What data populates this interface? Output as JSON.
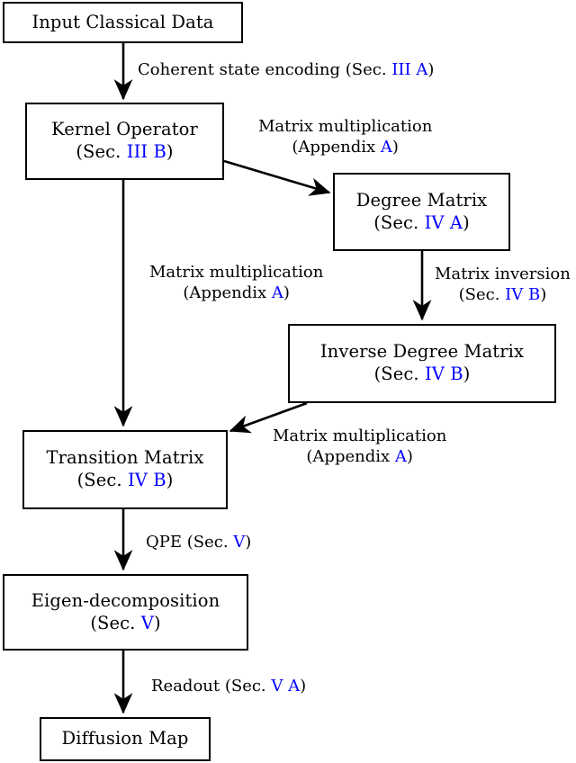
{
  "diagram": {
    "title": "Quantum Diffusion Map Pipeline Flowchart",
    "accent_color": "#0000ff",
    "line_color": "#000000",
    "background": "#ffffff"
  },
  "nodes": [
    {
      "id": "input",
      "line1": "Input Classical Data",
      "line2": "",
      "ref": ""
    },
    {
      "id": "kernel",
      "line1": "Kernel Operator",
      "line2": "(Sec. ",
      "ref": "III B",
      "close": ")"
    },
    {
      "id": "degree",
      "line1": "Degree Matrix",
      "line2": "(Sec. ",
      "ref": "IV A",
      "close": ")"
    },
    {
      "id": "invdegree",
      "line1": "Inverse Degree Matrix",
      "line2": "(Sec. ",
      "ref": "IV B",
      "close": ")"
    },
    {
      "id": "transition",
      "line1": "Transition Matrix",
      "line2": "(Sec. ",
      "ref": "IV B",
      "close": ")"
    },
    {
      "id": "eigen",
      "line1": "Eigen-decomposition",
      "line2": "(Sec. ",
      "ref": "V",
      "close": ")"
    },
    {
      "id": "diffusionmap",
      "line1": "Diffusion Map",
      "line2": "",
      "ref": ""
    }
  ],
  "edge_labels": [
    {
      "id": "coherent",
      "l1_pre": "Coherent state encoding (Sec. ",
      "l1_ref": "III A",
      "l1_post": ")",
      "l2_pre": "",
      "l2_ref": "",
      "l2_post": ""
    },
    {
      "id": "matmul_top",
      "l1_pre": "Matrix multiplication",
      "l1_ref": "",
      "l1_post": "",
      "l2_pre": "(Appendix ",
      "l2_ref": "A",
      "l2_post": ")"
    },
    {
      "id": "matmul_mid",
      "l1_pre": "Matrix multiplication",
      "l1_ref": "",
      "l1_post": "",
      "l2_pre": "(Appendix ",
      "l2_ref": "A",
      "l2_post": ")"
    },
    {
      "id": "matinv",
      "l1_pre": "Matrix inversion",
      "l1_ref": "",
      "l1_post": "",
      "l2_pre": "(Sec. ",
      "l2_ref": "IV B",
      "l2_post": ")"
    },
    {
      "id": "matmul_bot",
      "l1_pre": "Matrix multiplication",
      "l1_ref": "",
      "l1_post": "",
      "l2_pre": "(Appendix ",
      "l2_ref": "A",
      "l2_post": ")"
    },
    {
      "id": "qpe",
      "l1_pre": "QPE (Sec. ",
      "l1_ref": "V",
      "l1_post": ")",
      "l2_pre": "",
      "l2_ref": "",
      "l2_post": ""
    },
    {
      "id": "readout",
      "l1_pre": "Readout (Sec. ",
      "l1_ref": "V A",
      "l1_post": ")",
      "l2_pre": "",
      "l2_ref": "",
      "l2_post": ""
    }
  ],
  "chart_data": {
    "type": "diagram",
    "flow": [
      {
        "from": "Input Classical Data",
        "to": "Kernel Operator",
        "label": "Coherent state encoding (Sec. III A)"
      },
      {
        "from": "Kernel Operator",
        "to": "Degree Matrix",
        "label": "Matrix multiplication (Appendix A)"
      },
      {
        "from": "Degree Matrix",
        "to": "Inverse Degree Matrix",
        "label": "Matrix inversion (Sec. IV B)"
      },
      {
        "from": "Kernel Operator",
        "to": "Transition Matrix",
        "label": "Matrix multiplication (Appendix A)"
      },
      {
        "from": "Inverse Degree Matrix",
        "to": "Transition Matrix",
        "label": "Matrix multiplication (Appendix A)"
      },
      {
        "from": "Transition Matrix",
        "to": "Eigen-decomposition",
        "label": "QPE (Sec. V)"
      },
      {
        "from": "Eigen-decomposition",
        "to": "Diffusion Map",
        "label": "Readout (Sec. V A)"
      }
    ]
  }
}
